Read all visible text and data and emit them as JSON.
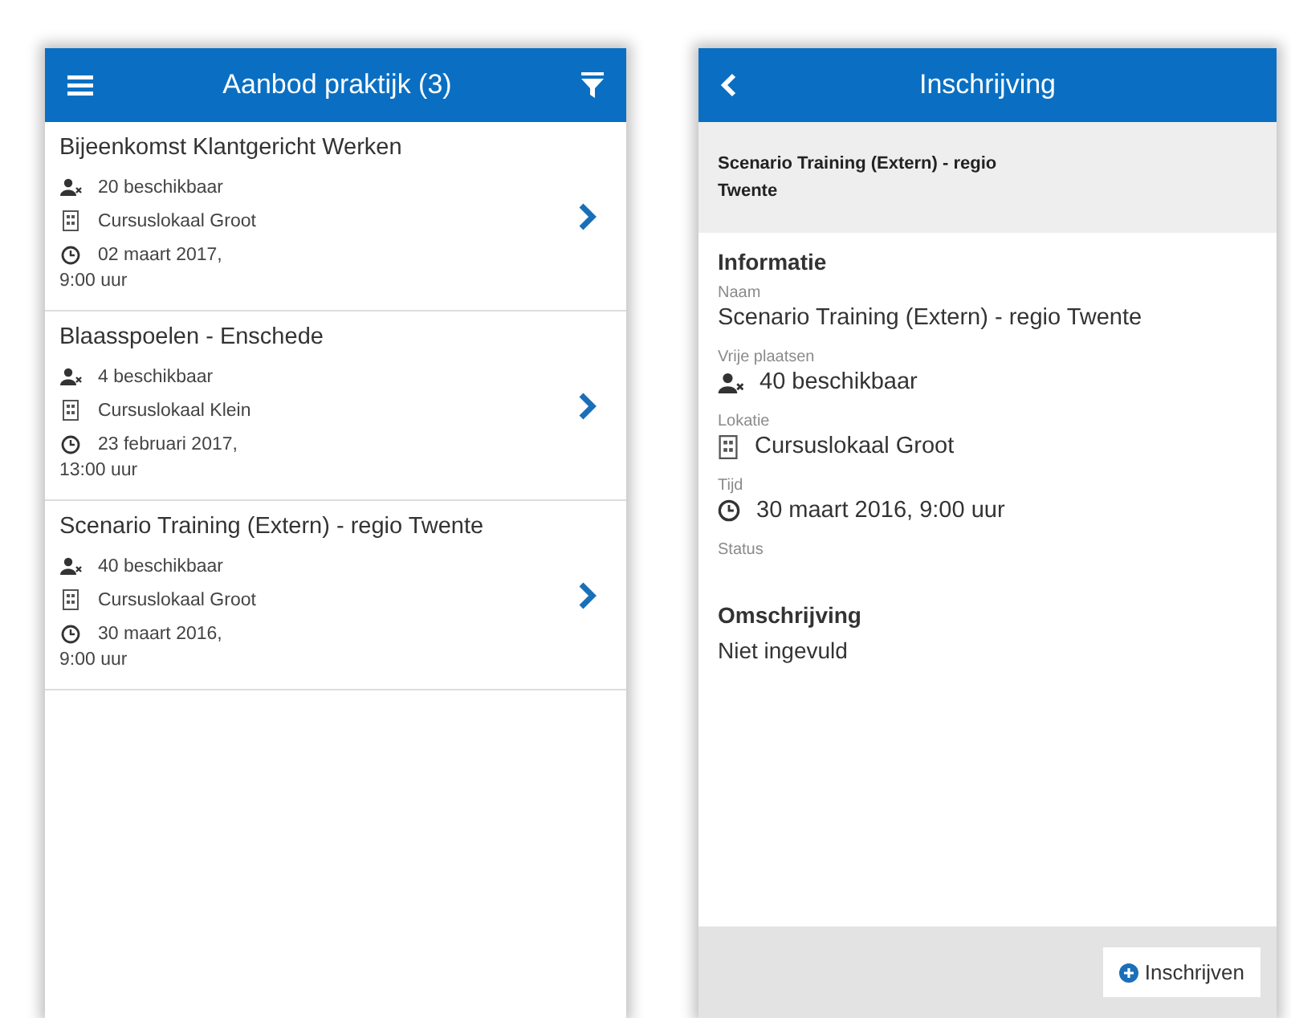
{
  "list_screen": {
    "title": "Aanbod praktijk (3)",
    "items": [
      {
        "title": "Bijeenkomst Klantgericht Werken",
        "places": "20 beschikbaar",
        "location": "Cursuslokaal Groot",
        "date": "02 maart 2017,",
        "time": "9:00 uur"
      },
      {
        "title": "Blaasspoelen - Enschede",
        "places": "4 beschikbaar",
        "location": "Cursuslokaal Klein",
        "date": "23 februari 2017,",
        "time": "13:00 uur"
      },
      {
        "title": "Scenario Training (Extern) - regio Twente",
        "places": "40 beschikbaar",
        "location": "Cursuslokaal Groot",
        "date": "30 maart 2016,",
        "time": "9:00 uur"
      }
    ]
  },
  "detail_screen": {
    "title": "Inschrijving",
    "subtitle": "Scenario Training (Extern) - regio Twente",
    "section": "Informatie",
    "fields": [
      {
        "label": "Naam",
        "value": "Scenario Training (Extern) - regio Twente"
      },
      {
        "label": "Vrije plaatsen",
        "value": "40 beschikbaar",
        "kind": "people"
      },
      {
        "label": "Lokatie",
        "value": "Cursuslokaal Groot",
        "kind": "room"
      },
      {
        "label": "Tijd",
        "value": "30 maart 2016, 9:00 uur",
        "kind": "clock"
      },
      {
        "label": "Status"
      }
    ],
    "description_heading": "Omschrijving",
    "description": "Niet ingevuld",
    "button": "Inschrijven"
  }
}
